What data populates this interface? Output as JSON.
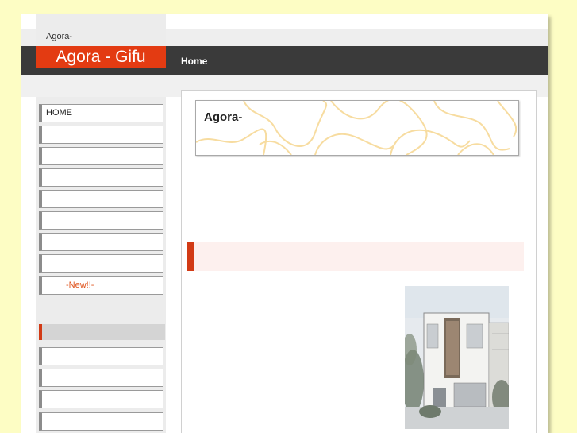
{
  "header": {
    "site_subtitle": "Agora-",
    "logo_text": "Agora - Gifu",
    "nav_home": "Home"
  },
  "sidebar": {
    "items": [
      {
        "label": "HOME"
      },
      {
        "label": ""
      },
      {
        "label": ""
      },
      {
        "label": ""
      },
      {
        "label": ""
      },
      {
        "label": ""
      },
      {
        "label": ""
      },
      {
        "label": ""
      },
      {
        "label": "-New!!-"
      }
    ],
    "section2_items": [
      {
        "label": ""
      },
      {
        "label": ""
      },
      {
        "label": ""
      },
      {
        "label": ""
      }
    ]
  },
  "main": {
    "title": "Agora-"
  },
  "colors": {
    "page_bg": "#fdfdc4",
    "accent_red": "#e33b12",
    "header_dark": "#3a3a3a",
    "new_orange": "#e0551f",
    "pattern_yellow": "#f7dca0"
  }
}
